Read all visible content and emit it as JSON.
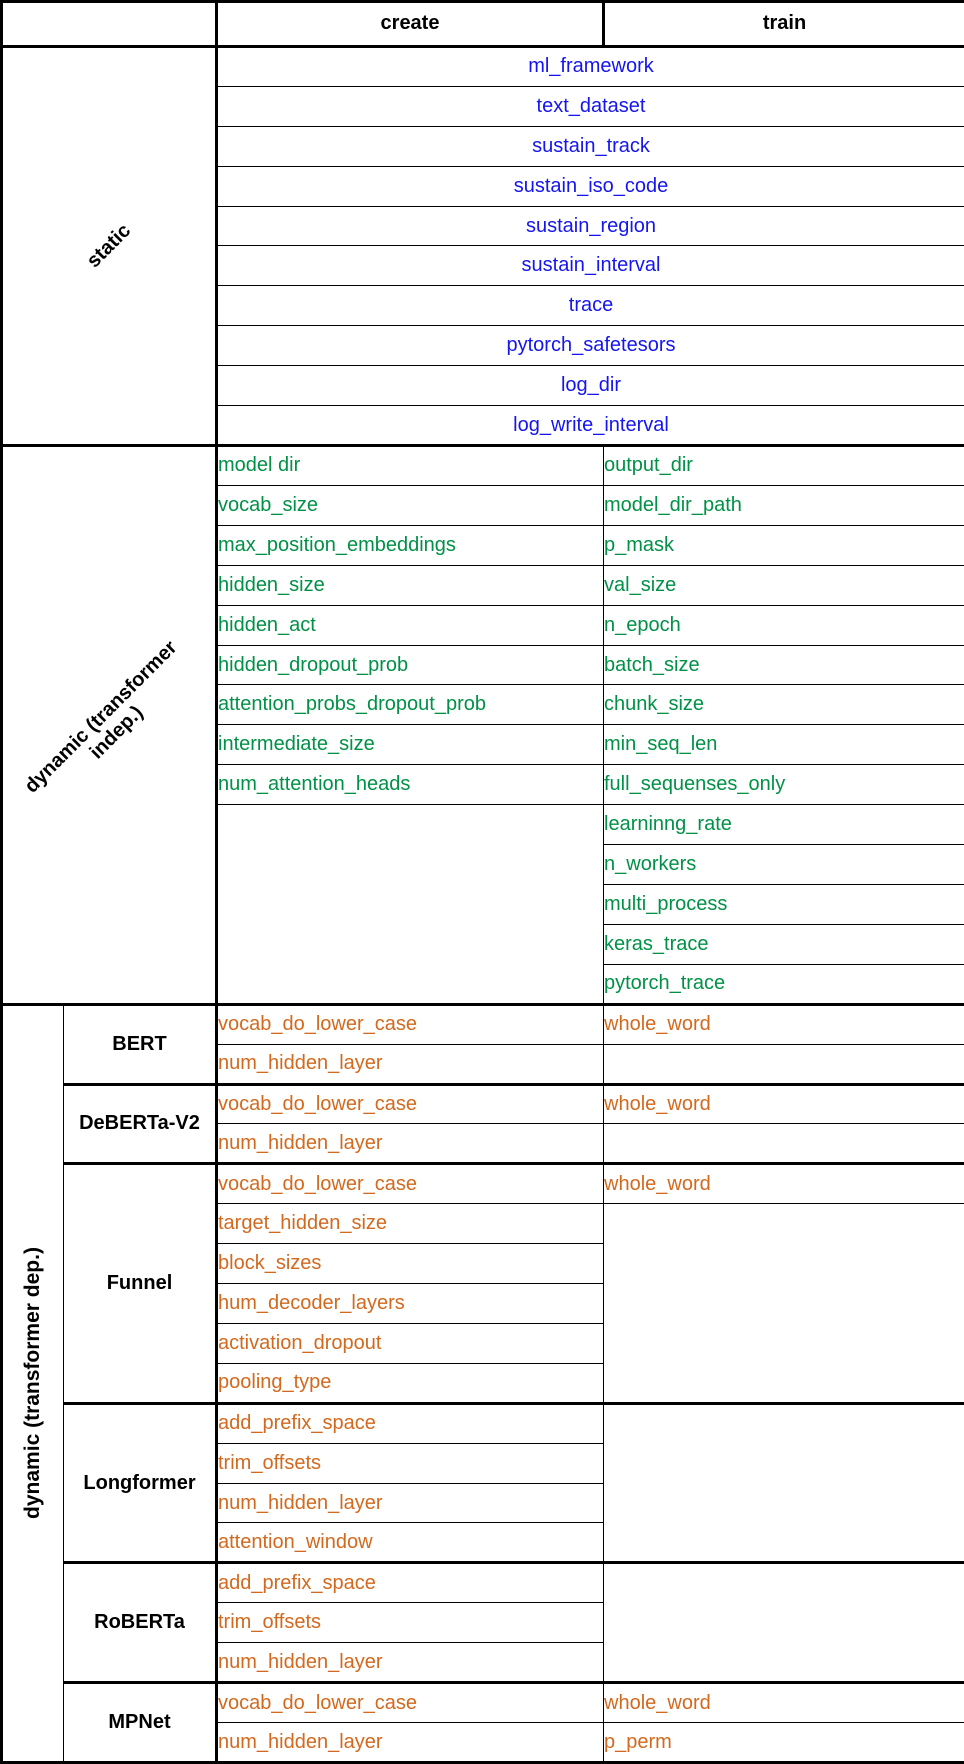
{
  "table": {
    "column_headers": {
      "corner": "",
      "create": "create",
      "train": "train"
    },
    "row_group_labels": {
      "static": "static",
      "dynamic_indep": "dynamic (transformer\nindep.)",
      "dynamic_dep": "dynamic (transformer dep.)"
    },
    "colors": {
      "static": "#1515f0",
      "dynamic_indep": "#009146",
      "dynamic_dep": "#d2691e",
      "header_text": "#000000",
      "border": "#000000",
      "background": "#ffffff"
    },
    "sections": [
      {
        "id": "static",
        "label": "static",
        "spanned": true,
        "rows": [
          "ml_framework",
          "text_dataset",
          "sustain_track",
          "sustain_iso_code",
          "sustain_region",
          "sustain_interval",
          "trace",
          "pytorch_safetesors",
          "log_dir",
          "log_write_interval"
        ]
      },
      {
        "id": "dynamic_indep",
        "label": "dynamic (transformer indep.)",
        "spanned": false,
        "create": [
          "model dir",
          "vocab_size",
          "max_position_embeddings",
          "hidden_size",
          "hidden_act",
          "hidden_dropout_prob",
          "attention_probs_dropout_prob",
          "intermediate_size",
          "num_attention_heads"
        ],
        "train": [
          "output_dir",
          "model_dir_path",
          "p_mask",
          "val_size",
          "n_epoch",
          "batch_size",
          "chunk_size",
          "min_seq_len",
          "full_sequenses_only",
          "learninng_rate",
          "n_workers",
          "multi_process",
          "keras_trace",
          "pytorch_trace"
        ]
      },
      {
        "id": "dynamic_dep",
        "label": "dynamic (transformer dep.)",
        "models": [
          {
            "name": "BERT",
            "create": [
              "vocab_do_lower_case",
              "num_hidden_layer"
            ],
            "train": [
              "whole_word",
              ""
            ]
          },
          {
            "name": "DeBERTa-V2",
            "create": [
              "vocab_do_lower_case",
              "num_hidden_layer"
            ],
            "train": [
              "whole_word",
              ""
            ]
          },
          {
            "name": "Funnel",
            "create": [
              "vocab_do_lower_case",
              "target_hidden_size",
              "block_sizes",
              "hum_decoder_layers",
              "activation_dropout",
              "pooling_type"
            ],
            "train": [
              "whole_word",
              "",
              "",
              "",
              "",
              ""
            ]
          },
          {
            "name": "Longformer",
            "create": [
              "add_prefix_space",
              "trim_offsets",
              "num_hidden_layer",
              "attention_window"
            ],
            "train": [
              "",
              "",
              "",
              ""
            ]
          },
          {
            "name": "RoBERTa",
            "create": [
              "add_prefix_space",
              "trim_offsets",
              "num_hidden_layer"
            ],
            "train": [
              "",
              "",
              ""
            ]
          },
          {
            "name": "MPNet",
            "create": [
              "vocab_do_lower_case",
              "num_hidden_layer"
            ],
            "train": [
              "whole_word",
              "p_perm"
            ]
          }
        ]
      }
    ]
  }
}
